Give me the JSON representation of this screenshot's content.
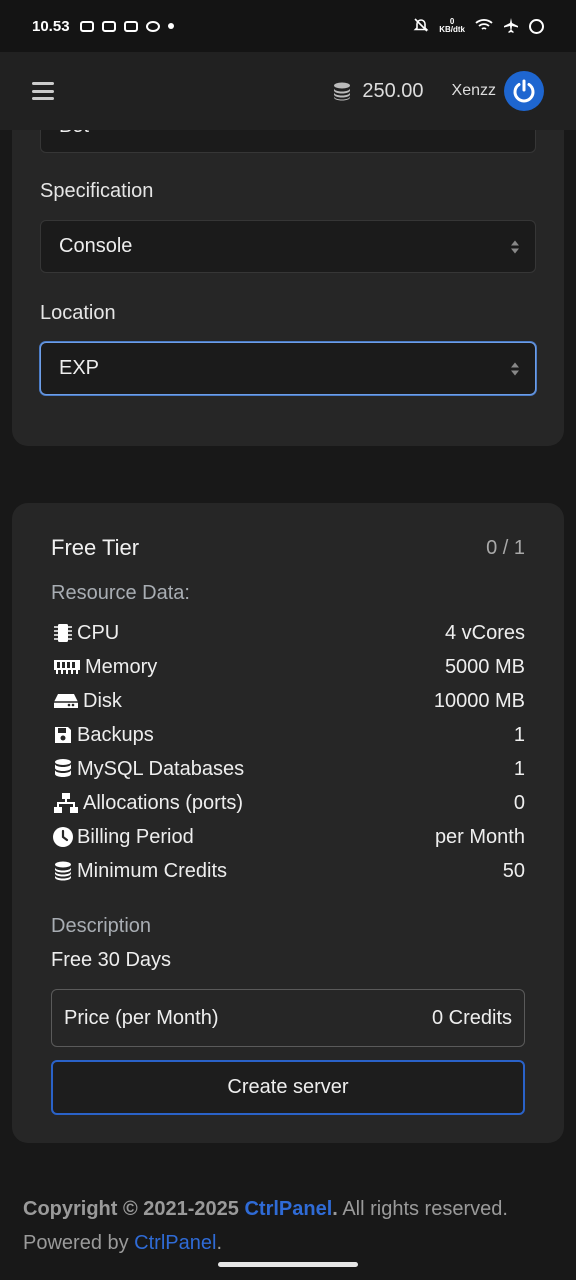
{
  "status_bar": {
    "time": "10.53",
    "net_speed_value": "0",
    "net_speed_unit": "KB/dtk"
  },
  "navbar": {
    "credits": "250.00",
    "username": "Xenzz"
  },
  "form": {
    "partial_select_value": "Bot",
    "specification_label": "Specification",
    "specification_value": "Console",
    "location_label": "Location",
    "location_value": "EXP"
  },
  "plan": {
    "title": "Free Tier",
    "count": "0 / 1",
    "resource_header": "Resource Data:",
    "resources": [
      {
        "icon": "cpu-icon",
        "label": "CPU",
        "value": "4 vCores"
      },
      {
        "icon": "memory-icon",
        "label": "Memory",
        "value": "5000 MB"
      },
      {
        "icon": "disk-icon",
        "label": "Disk",
        "value": "10000 MB"
      },
      {
        "icon": "save-icon",
        "label": "Backups",
        "value": "1"
      },
      {
        "icon": "database-icon",
        "label": "MySQL Databases",
        "value": "1"
      },
      {
        "icon": "network-icon",
        "label": "Allocations (ports)",
        "value": "0"
      },
      {
        "icon": "clock-icon",
        "label": "Billing Period",
        "value": "per Month"
      },
      {
        "icon": "coins-icon",
        "label": "Minimum Credits",
        "value": "50"
      }
    ],
    "description_header": "Description",
    "description": "Free 30 Days",
    "price_label": "Price (per Month)",
    "price_value": "0 Credits",
    "create_button": "Create server"
  },
  "footer": {
    "copyright_prefix": "Copyright © 2021-2025 ",
    "brand": "CtrlPanel",
    "copyright_dot": ".",
    "rights": " All rights reserved.",
    "powered_prefix": "Powered by ",
    "powered_link": "CtrlPanel",
    "powered_suffix": "."
  },
  "colors": {
    "accent": "#2a62c8",
    "background": "#181818",
    "card": "#262626"
  }
}
